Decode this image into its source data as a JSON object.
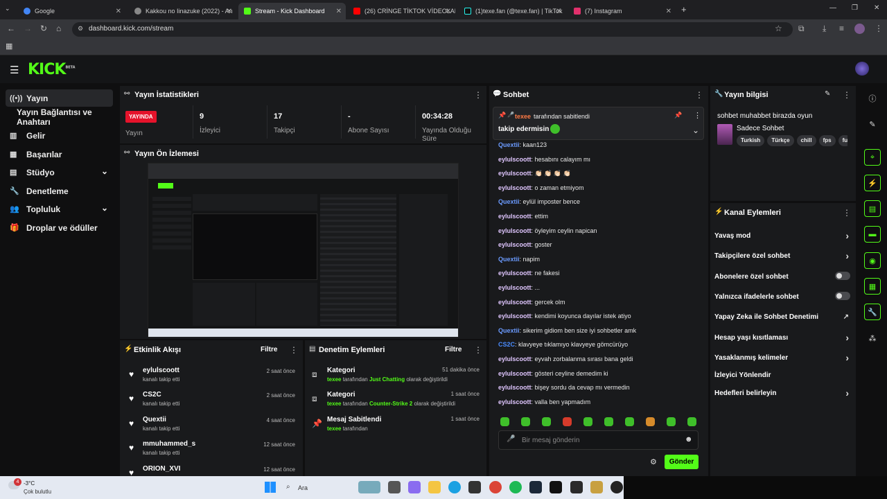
{
  "browser": {
    "tabs": [
      {
        "title": "Google",
        "color": "#4285f4"
      },
      {
        "title": "Kakkou no Iinazuke (2022) - An",
        "color": "#cccccc"
      },
      {
        "title": "Stream - Kick Dashboard",
        "color": "#53fc18"
      },
      {
        "title": "(26) CRİNGE TİKTOK VİDEOLARI",
        "color": "#ff0000"
      },
      {
        "title": "(1)texe.fan (@texe.fan) | TikTok",
        "color": "#000000"
      },
      {
        "title": "(7) Instagram",
        "color": "#e1306c"
      }
    ],
    "url": "dashboard.kick.com/stream"
  },
  "app": {
    "logo": "KICK",
    "logo_badge": "BETA"
  },
  "sidebar": [
    {
      "label": "Yayın",
      "icon": "broadcast-icon"
    },
    {
      "label": "Yayın Bağlantısı ve Anahtarı",
      "icon": ""
    },
    {
      "label": "Gelir",
      "icon": "revenue-icon"
    },
    {
      "label": "Başarılar",
      "icon": "achievements-icon"
    },
    {
      "label": "Stüdyo",
      "icon": "studio-icon"
    },
    {
      "label": "Denetleme",
      "icon": "wrench-icon"
    },
    {
      "label": "Topluluk",
      "icon": "community-icon"
    },
    {
      "label": "Droplar ve ödüller",
      "icon": "gift-icon"
    }
  ],
  "stats": {
    "title": "Yayın İstatistikleri",
    "live_badge": "YAYINDA",
    "live_label": "Yayın",
    "items": [
      {
        "value": "9",
        "label": "İzleyici"
      },
      {
        "value": "17",
        "label": "Takipçi"
      },
      {
        "value": "-",
        "label": "Abone Sayısı"
      },
      {
        "value": "00:34:28",
        "label": "Yayında Olduğu Süre"
      }
    ]
  },
  "preview": {
    "title": "Yayın Ön İzlemesi"
  },
  "activity": {
    "title": "Etkinlik Akışı",
    "filter": "Filtre",
    "items": [
      {
        "name": "eylulscoott",
        "sub": "kanalı takip etti",
        "time": "2 saat önce"
      },
      {
        "name": "CS2C",
        "sub": "kanalı takip etti",
        "time": "2 saat önce"
      },
      {
        "name": "Quextii",
        "sub": "kanalı takip etti",
        "time": "4 saat önce"
      },
      {
        "name": "mmuhammed_s",
        "sub": "kanalı takip etti",
        "time": "12 saat önce"
      },
      {
        "name": "ORION_XVI",
        "sub": "",
        "time": "12 saat önce"
      }
    ]
  },
  "moderation": {
    "title": "Denetim Eylemleri",
    "filter": "Filtre",
    "items": [
      {
        "name": "Kategori",
        "user": "texee",
        "mid": "tarafından",
        "value": "Just Chatting",
        "end": "olarak değiştirildi",
        "time": "51 dakika önce"
      },
      {
        "name": "Kategori",
        "user": "texee",
        "mid": "tarafından",
        "value": "Counter-Strike 2",
        "end": "olarak değiştirildi",
        "time": "1 saat önce"
      },
      {
        "name": "Mesaj Sabitlendi",
        "user": "texee",
        "mid": "tarafından",
        "value": "",
        "end": "",
        "time": "1 saat önce"
      }
    ]
  },
  "chat": {
    "title": "Sohbet",
    "pinned_by_user": "texee",
    "pinned_by_text": "tarafından sabitlendi",
    "pinned_message": "takip edermisin",
    "messages": [
      {
        "user": "Quextii",
        "text": ": kaan123",
        "color": "#6b9bff"
      },
      {
        "user": "eylulscoott",
        "text": ": hesabını calayım mı",
        "color": "#e0c6ff"
      },
      {
        "user": "eylulscoott",
        "text": ": 👏🏻 👏🏻 👏🏻 👏🏻",
        "color": "#e0c6ff"
      },
      {
        "user": "eylulscoott",
        "text": ": o zaman etmiyom",
        "color": "#e0c6ff"
      },
      {
        "user": "Quextii",
        "text": ": eylül imposter bence",
        "color": "#6b9bff"
      },
      {
        "user": "eylulscoott",
        "text": ": ettim",
        "color": "#e0c6ff"
      },
      {
        "user": "eylulscoott",
        "text": ": öyleyim ceylin napican",
        "color": "#e0c6ff"
      },
      {
        "user": "eylulscoott",
        "text": ": goster",
        "color": "#e0c6ff"
      },
      {
        "user": "Quextii",
        "text": ": napim",
        "color": "#6b9bff"
      },
      {
        "user": "eylulscoott",
        "text": ": ne fakesi",
        "color": "#e0c6ff"
      },
      {
        "user": "eylulscoott",
        "text": ": ...",
        "color": "#e0c6ff"
      },
      {
        "user": "eylulscoott",
        "text": ": gercek olm",
        "color": "#e0c6ff"
      },
      {
        "user": "eylulscoott",
        "text": ": kendimi koyunca dayılar istek atiyo",
        "color": "#e0c6ff"
      },
      {
        "user": "Quextii",
        "text": ": sikerim gidiom ben size iyi sohbetler amk",
        "color": "#6b9bff"
      },
      {
        "user": "CS2C",
        "text": ": klavyeye tıklamıyo klavyeye gömcürüyo",
        "color": "#4a8cff"
      },
      {
        "user": "eylulscoott",
        "text": ": eyvah zorbalanma sırası bana geldi",
        "color": "#e0c6ff"
      },
      {
        "user": "eylulscoott",
        "text": ": gösteri ceyline demedim ki",
        "color": "#e0c6ff"
      },
      {
        "user": "eylulscoott",
        "text": ": bişey sordu da cevap mı vermedin",
        "color": "#e0c6ff"
      },
      {
        "user": "eylulscoott",
        "text": ": valla ben yapmadım",
        "color": "#e0c6ff"
      }
    ],
    "input_placeholder": "Bir mesaj gönderin",
    "send_label": "Gönder"
  },
  "stream_info": {
    "title": "Yayın bilgisi",
    "stream_title": "sohbet muhabbet birazda oyun",
    "category": "Sadece Sohbet",
    "tags": [
      "Turkish",
      "Türkçe",
      "chill",
      "fps",
      "fu"
    ]
  },
  "channel_actions": {
    "title": "Kanal Eylemleri",
    "items": [
      {
        "label": "Yavaş mod",
        "control": "chevron"
      },
      {
        "label": "Takipçilere özel sohbet",
        "control": "chevron"
      },
      {
        "label": "Abonelere özel sohbet",
        "control": "toggle"
      },
      {
        "label": "Yalnızca ifadelerle sohbet",
        "control": "toggle"
      },
      {
        "label": "Yapay Zeka ile Sohbet Denetimi",
        "control": "external"
      },
      {
        "label": "Hesap yaşı kısıtlaması",
        "control": "chevron"
      },
      {
        "label": "Yasaklanmış kelimeler",
        "control": "chevron"
      },
      {
        "label": "İzleyici Yönlendir",
        "control": "none"
      },
      {
        "label": "Hedefleri belirleyin",
        "control": "chevron"
      }
    ]
  },
  "taskbar": {
    "weather_temp": "-3°C",
    "weather_text": "Çok bulutlu",
    "weather_badge": "4",
    "search_label": "Ara"
  },
  "colors": {
    "accent": "#53fc18",
    "live": "#e5132b"
  }
}
